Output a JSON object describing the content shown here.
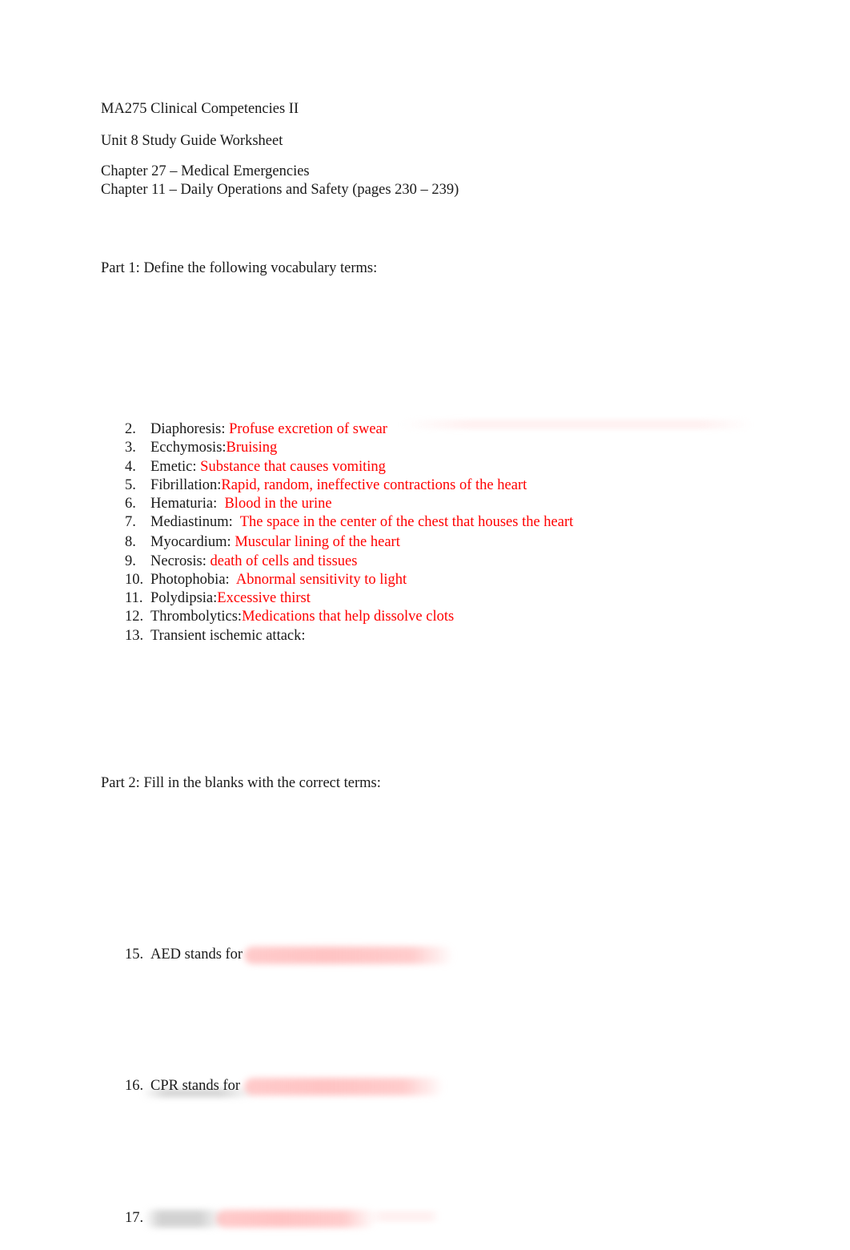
{
  "header": {
    "course": "MA275 Clinical Competencies II",
    "worksheet": "Unit 8 Study Guide Worksheet",
    "chapter_a": "Chapter 27 – Medical Emergencies",
    "chapter_b": "Chapter 11 – Daily Operations and Safety (pages 230 – 239)"
  },
  "part1": {
    "heading": "Part 1: Define the following vocabulary terms:",
    "items": [
      {
        "num": "2.",
        "term": "Diaphoresis: ",
        "answer": "Profuse excretion of swear"
      },
      {
        "num": "3.",
        "term": "Ecchymosis:",
        "answer": "Bruising"
      },
      {
        "num": "4.",
        "term": "Emetic: ",
        "answer": "Substance that causes vomiting"
      },
      {
        "num": "5.",
        "term": "Fibrillation:",
        "answer": "Rapid, random, ineffective contractions of the heart"
      },
      {
        "num": "6.",
        "term": "Hematuria:  ",
        "answer": "Blood in the urine"
      },
      {
        "num": "7.",
        "term": "Mediastinum:  ",
        "answer": "The space in the center of the chest that houses the heart"
      },
      {
        "num": "8.",
        "term": "Myocardium: ",
        "answer": "Muscular lining of the heart"
      },
      {
        "num": "9.",
        "term": "Necrosis: ",
        "answer": "death of cells and tissues"
      },
      {
        "num": "10.",
        "term": "Photophobia:  ",
        "answer": "Abnormal sensitivity to light"
      },
      {
        "num": "11.",
        "term": "Polydipsia:",
        "answer": "Excessive thirst"
      },
      {
        "num": "12.",
        "term": "Thrombolytics:",
        "answer": "Medications that help dissolve clots"
      },
      {
        "num": "13.",
        "term": "Transient ischemic attack:",
        "answer": ""
      }
    ]
  },
  "part2": {
    "heading": "Part 2: Fill in the blanks with the correct terms:",
    "items": [
      {
        "num": "15.",
        "text": "AED stands for"
      },
      {
        "num": "16.",
        "text": "CPR stands for"
      },
      {
        "num": "17.",
        "text": ""
      }
    ]
  }
}
